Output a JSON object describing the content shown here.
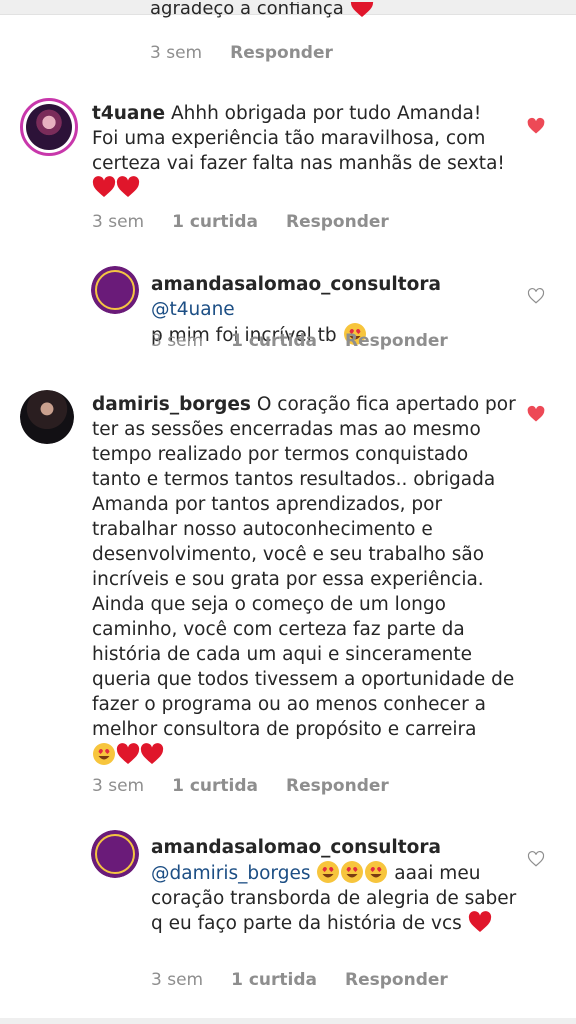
{
  "partial_comment": {
    "text": "agradeço a confiança",
    "time": "3 sem",
    "reply": "Responder"
  },
  "comments": [
    {
      "username": "t4uane",
      "text": " Ahhh obrigada por tudo Amanda! Foi uma experiência tão maravilhosa, com certeza vai fazer falta nas manhãs de sexta!",
      "time": "3 sem",
      "likes": "1 curtida",
      "reply": "Responder",
      "liked": true
    },
    {
      "username": "amandasalomao_consultora",
      "mention": "@t4uane",
      "text": "p mim foi incrível tb",
      "time": "3 sem",
      "likes": "1 curtida",
      "reply": "Responder",
      "liked": false
    },
    {
      "username": "damiris_borges",
      "text": " O coração fica apertado por ter as sessões encerradas mas ao mesmo tempo realizado por termos conquistado tanto e termos tantos resultados.. obrigada Amanda por tantos aprendizados, por trabalhar nosso autoconhecimento e desenvolvimento, você e seu trabalho são incríveis e sou grata por essa experiência. Ainda que seja o começo de um longo caminho, você com certeza faz parte da história de cada um aqui e sinceramente queria que todos tivessem a oportunidade de fazer o programa ou ao menos conhecer a melhor consultora de propósito e carreira",
      "time": "3 sem",
      "likes": "1 curtida",
      "reply": "Responder",
      "liked": true
    },
    {
      "username": "amandasalomao_consultora",
      "mention": "@damiris_borges",
      "text": "aaai meu coração transborda de alegria de saber q eu faço parte da história de vcs",
      "time": "3 sem",
      "likes": "1 curtida",
      "reply": "Responder",
      "liked": false
    }
  ],
  "colors": {
    "like_active": "#ed4956",
    "meta": "#8e8e8e",
    "mention": "#1c4e84"
  },
  "icons": {
    "like": "heart-icon",
    "emoji_heart": "red-heart-emoji",
    "emoji_face": "heart-eyes-emoji",
    "emoji_hug": "smiling-face-with-hearts-emoji"
  }
}
